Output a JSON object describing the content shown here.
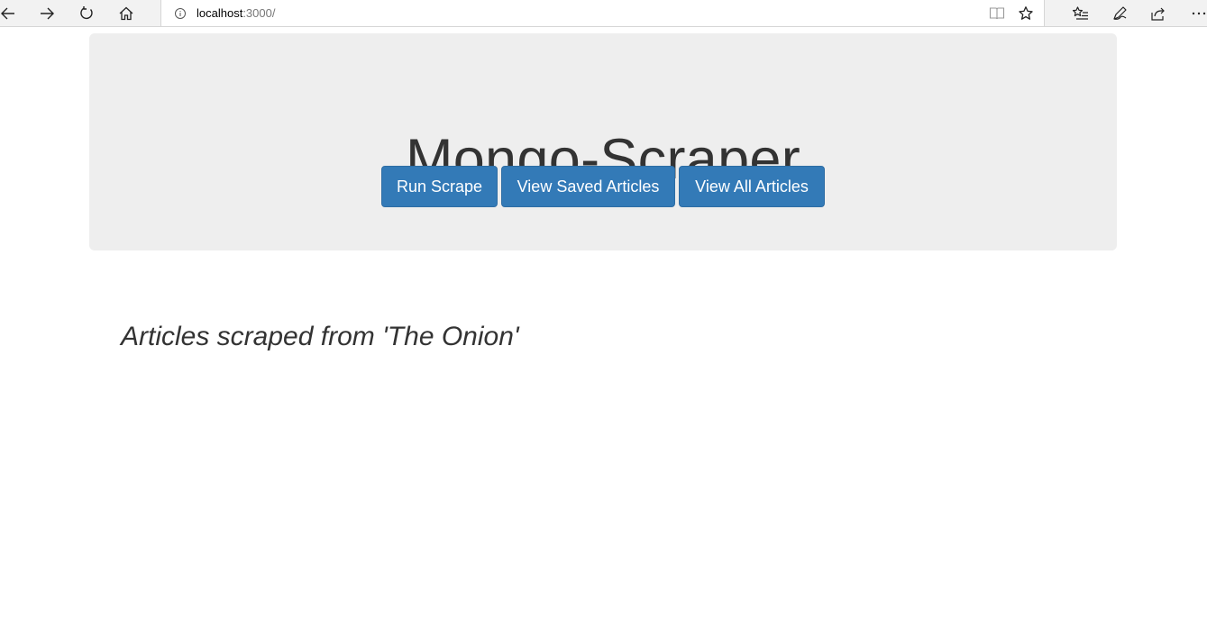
{
  "browser": {
    "url_host": "localhost",
    "url_rest": ":3000/",
    "icons": {
      "back": "back-arrow-icon",
      "forward": "forward-arrow-icon",
      "refresh": "refresh-icon",
      "home": "home-icon",
      "info": "info-icon",
      "reading_view": "reading-view-icon",
      "favorite": "star-icon",
      "favorites_hub": "favorites-list-icon",
      "notes": "pen-icon",
      "share": "share-icon",
      "more": "more-dots-icon"
    }
  },
  "header": {
    "title": "Mongo-Scraper",
    "buttons": {
      "run_scrape": "Run Scrape",
      "view_saved": "View Saved Articles",
      "view_all": "View All Articles"
    }
  },
  "main": {
    "subheading": "Articles scraped from 'The Onion'"
  },
  "colors": {
    "button_primary": "#337ab7",
    "jumbotron_bg": "#eeeeee",
    "text": "#333333"
  }
}
